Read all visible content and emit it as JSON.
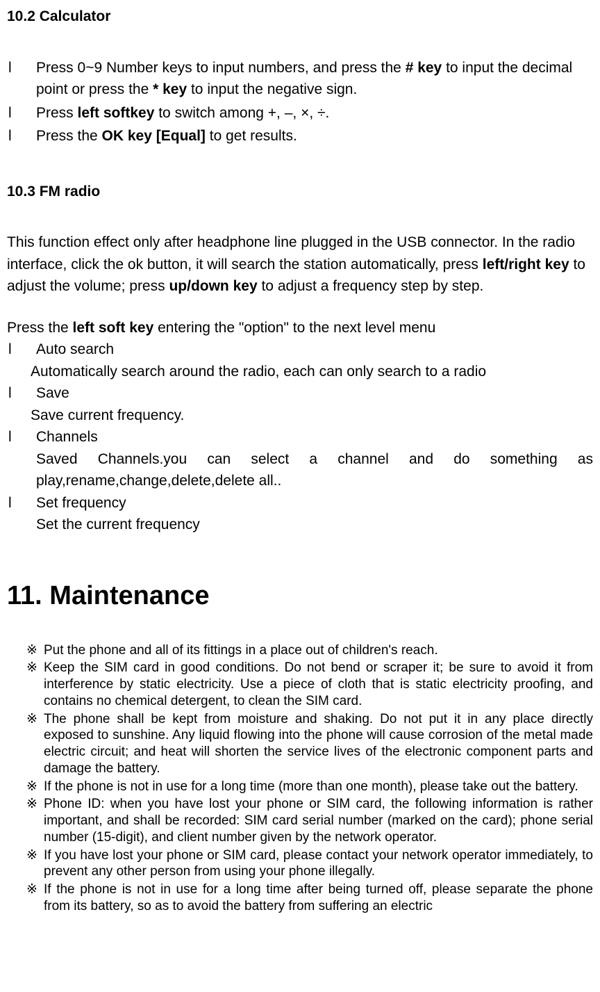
{
  "section_10_2": {
    "heading": "10.2 Calculator",
    "bullets": [
      {
        "marker": "l",
        "parts": [
          {
            "t": "Press 0~9 Number keys to input numbers, and press the ",
            "b": false
          },
          {
            "t": "# key",
            "b": true
          },
          {
            "t": " to input the decimal point or press the ",
            "b": false
          },
          {
            "t": "* key",
            "b": true
          },
          {
            "t": " to input the negative sign.",
            "b": false
          }
        ]
      },
      {
        "marker": "l",
        "parts": [
          {
            "t": "Press ",
            "b": false
          },
          {
            "t": "left softkey",
            "b": true
          },
          {
            "t": " to switch among +, –, ×, ÷.",
            "b": false
          }
        ]
      },
      {
        "marker": "l",
        "parts": [
          {
            "t": "Press the ",
            "b": false
          },
          {
            "t": "OK key [Equal]",
            "b": true
          },
          {
            "t": " to get results.",
            "b": false
          }
        ]
      }
    ]
  },
  "section_10_3": {
    "heading": "10.3 FM radio",
    "intro_parts": [
      {
        "t": "This function effect only after headphone line plugged in the USB connector.\nIn the radio interface, click the ok button, it will search the station automatically, press ",
        "b": false
      },
      {
        "t": "left/right key",
        "b": true
      },
      {
        "t": " to adjust the volume; press ",
        "b": false
      },
      {
        "t": "up/down key",
        "b": true
      },
      {
        "t": " to adjust   a frequency step by step.",
        "b": false
      }
    ],
    "option_intro_parts": [
      {
        "t": "Press the ",
        "b": false
      },
      {
        "t": "left soft key",
        "b": true
      },
      {
        "t": " entering the \"option\" to the next level menu",
        "b": false
      }
    ],
    "options": [
      {
        "marker": "l",
        "label": "Auto search",
        "desc": "Automatically search around the radio, each can only search to a radio",
        "desc_class": "fm-desc-indent"
      },
      {
        "marker": "l",
        "label": "Save",
        "desc": "Save current frequency.",
        "desc_class": "fm-desc-indent"
      },
      {
        "marker": "l",
        "label": "Channels",
        "desc": "Saved Channels.you can select a channel and do something as play,rename,change,delete,delete all..",
        "desc_class": "fm-desc-indent2"
      },
      {
        "marker": "l",
        "label": "Set frequency",
        "desc": "Set the current frequency",
        "desc_class": "fm-desc-indent2"
      }
    ]
  },
  "chapter_11": {
    "heading": "11.  Maintenance",
    "items": [
      {
        "marker": "※",
        "text": "Put the phone and all of its fittings in a place out of children's reach."
      },
      {
        "marker": "※",
        "text": "Keep the SIM card in good conditions. Do not bend or scraper it; be sure to avoid it from interference by static electricity. Use a piece of cloth that is static electricity proofing, and contains no chemical detergent, to clean the SIM card."
      },
      {
        "marker": "※",
        "text": "The phone shall be kept from moisture and shaking. Do not put it in any place directly exposed to sunshine. Any liquid flowing into the phone will cause corrosion of the metal made electric circuit; and heat will shorten the service lives of the electronic component parts and damage the battery."
      },
      {
        "marker": "※",
        "text": "If the phone is not in use for a long time (more than one month), please take out the battery."
      },
      {
        "marker": "※",
        "text": "Phone ID: when you have lost your phone or SIM card, the following information is rather important, and shall be recorded: SIM card serial number (marked on the card); phone serial number (15-digit), and client number given by the network operator."
      },
      {
        "marker": "※",
        "text": "If you have lost your phone or SIM card, please contact your network operator immediately, to prevent any other person from using your phone illegally."
      },
      {
        "marker": "※",
        "text": "If the phone is not in use for a long time after being turned off, please separate the phone from its battery, so as  to avoid the battery from suffering an electric"
      }
    ]
  }
}
